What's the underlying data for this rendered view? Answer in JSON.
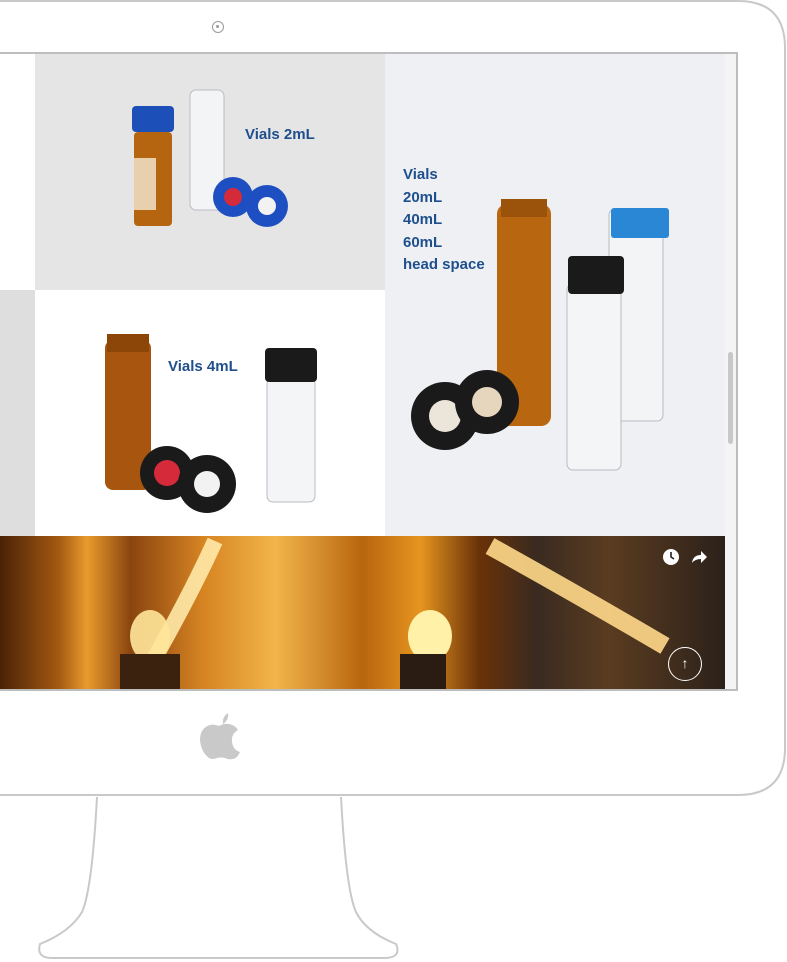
{
  "products": {
    "tile_2ml": {
      "label": "Vials 2mL"
    },
    "tile_4ml": {
      "label": "Vials 4mL"
    },
    "tile_big": {
      "label": "Vials\n20mL\n40mL\n60mL\nhead space"
    }
  },
  "video": {
    "clock_icon": "clock-icon",
    "share_icon": "share-icon",
    "scroll_top_icon": "arrow-up-icon"
  },
  "device": {
    "logo_icon": "apple-logo-icon"
  }
}
